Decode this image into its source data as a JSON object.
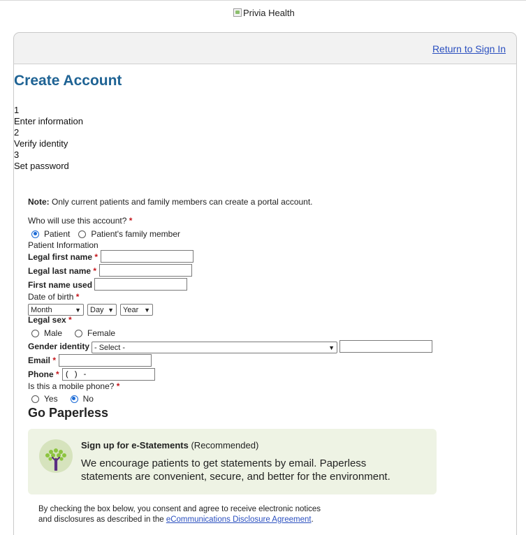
{
  "brand": {
    "logo_alt": "Privia Health"
  },
  "header": {
    "return_link": "Return to Sign In"
  },
  "page": {
    "title": "Create Account"
  },
  "steps": [
    {
      "number": "1",
      "label": "Enter information"
    },
    {
      "number": "2",
      "label": "Verify identity"
    },
    {
      "number": "3",
      "label": "Set password"
    }
  ],
  "note": {
    "prefix": "Note:",
    "text": " Only current patients and family members can create a portal account."
  },
  "who": {
    "question": "Who will use this account?",
    "options": [
      {
        "label": "Patient",
        "checked": true
      },
      {
        "label": "Patient's family member",
        "checked": false
      }
    ]
  },
  "patient_info": {
    "heading": "Patient Information"
  },
  "fields": {
    "first_name": {
      "label": "Legal first name",
      "value": ""
    },
    "last_name": {
      "label": "Legal last name",
      "value": ""
    },
    "first_name_used": {
      "label": "First name used",
      "value": ""
    },
    "dob": {
      "label": "Date of birth",
      "month": "Month",
      "day": "Day",
      "year": "Year"
    },
    "sex": {
      "label": "Legal sex",
      "options": [
        {
          "label": "Male"
        },
        {
          "label": "Female"
        }
      ]
    },
    "gender": {
      "label": "Gender identity",
      "selected": "- Select -",
      "other_value": ""
    },
    "email": {
      "label": "Email",
      "value": ""
    },
    "phone": {
      "label": "Phone",
      "value": "(   )   -"
    },
    "mobile": {
      "question": "Is this a mobile phone?",
      "options": [
        {
          "label": "Yes",
          "checked": false
        },
        {
          "label": "No",
          "checked": true
        }
      ]
    }
  },
  "paperless": {
    "heading": "Go Paperless",
    "title": "Sign up for e-Statements",
    "title_suffix": " (Recommended)",
    "body": "We encourage patients to get statements by email. Paperless statements are convenient, secure, and better for the environment."
  },
  "consent": {
    "line1": "By checking the box below, you consent and agree to receive electronic notices",
    "line2_prefix": "and disclosures as described in the ",
    "link": "eCommunications Disclosure Agreement",
    "line2_suffix": "."
  },
  "colors": {
    "accent": "#1f6394",
    "link": "#2a4fbf",
    "required": "#c4161c",
    "paperless_bg": "#eef3e4"
  }
}
